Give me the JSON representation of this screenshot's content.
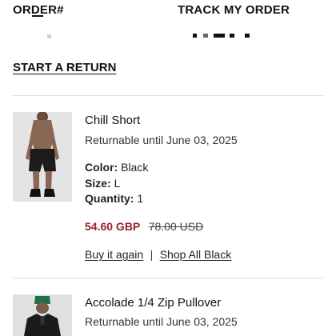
{
  "header": {
    "order_label": "ORDER#",
    "track_label": "TRACK MY ORDER"
  },
  "actions": {
    "start_return_label": "START A RETURN"
  },
  "items": [
    {
      "title": "Chill Short",
      "returnable": "Returnable until June 03, 2025",
      "color_label": "Color:",
      "color_value": "Black",
      "size_label": "Size:",
      "size_value": "L",
      "quantity_label": "Quantity:",
      "quantity_value": "1",
      "sale_price": "54.60 GBP",
      "original_price": "78.00 USD",
      "buy_again_label": "Buy it again",
      "separator": "|",
      "shop_link_label": "Shop All Black"
    },
    {
      "title": "Accolade 1/4 Zip Pullover",
      "returnable": "Returnable until June 03, 2025"
    }
  ],
  "colors": {
    "sale_price": "#9b1c2e",
    "divider": "#dcdcdc"
  }
}
